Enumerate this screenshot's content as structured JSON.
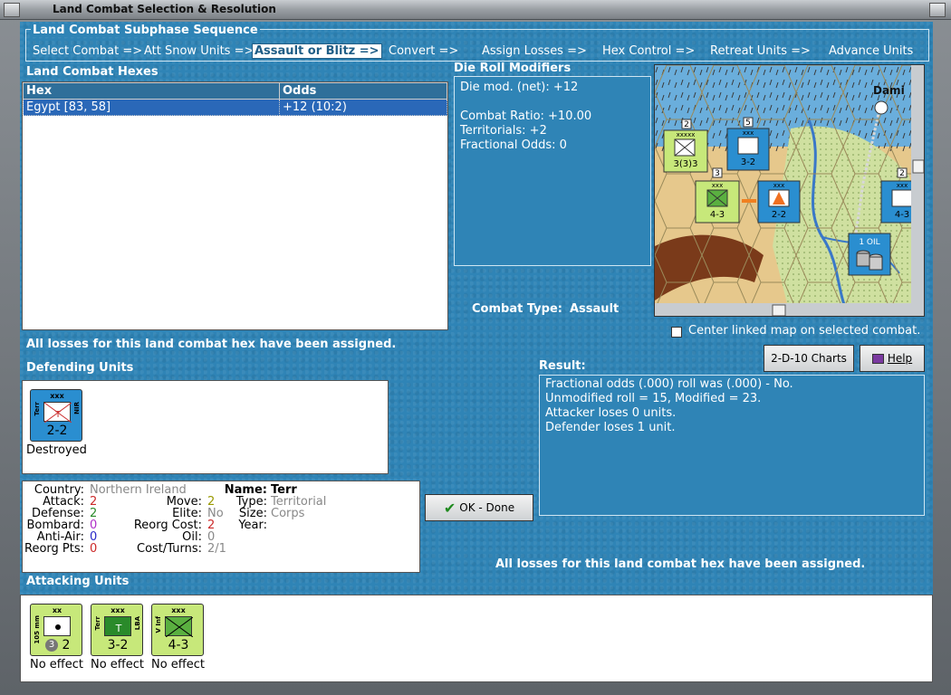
{
  "window": {
    "title": "Land Combat Selection & Resolution"
  },
  "sequence": {
    "title": "Land Combat Subphase Sequence",
    "items": [
      {
        "label": "Select Combat =>",
        "active": false
      },
      {
        "label": "Att Snow Units =>",
        "active": false
      },
      {
        "label": "Assault or Blitz =>",
        "active": true
      },
      {
        "label": "Convert =>",
        "active": false
      },
      {
        "label": "Assign Losses =>",
        "active": false
      },
      {
        "label": "Hex Control =>",
        "active": false
      },
      {
        "label": "Retreat Units =>",
        "active": false
      },
      {
        "label": "Advance Units",
        "active": false
      }
    ]
  },
  "hexes": {
    "title": "Land Combat Hexes",
    "columns": [
      "Hex",
      "Odds"
    ],
    "rows": [
      {
        "hex": "Egypt [83, 58]",
        "odds": "+12 (10:2)"
      }
    ]
  },
  "modifiers": {
    "title": "Die Roll Modifiers",
    "net": "Die mod. (net): +12",
    "ratio": "Combat Ratio: +10.00",
    "territorials": "Territorials: +2",
    "fractional": "Fractional Odds: 0"
  },
  "combat_type": {
    "label": "Combat Type:",
    "value": "Assault"
  },
  "map": {
    "checkbox_label": "Center linked map on selected combat.",
    "checked": false,
    "place_label": "Dami",
    "oil_label": "1 OIL",
    "stack_counts": [
      "2",
      "5",
      "3",
      "2"
    ],
    "units": [
      {
        "size": "xxxxx",
        "str": "3(3)3"
      },
      {
        "size": "xxx",
        "str": "3-2"
      },
      {
        "size": "xxx",
        "str": "4-3"
      },
      {
        "size": "xxx",
        "str": "2-2"
      },
      {
        "size": "xxx",
        "str": "4-3"
      }
    ]
  },
  "status_top": "All losses for this land combat hex have been assigned.",
  "status_bottom": "All losses for this land combat hex have been assigned.",
  "buttons": {
    "charts": "2-D-10 Charts",
    "help": "Help",
    "ok": "OK - Done"
  },
  "result": {
    "title": "Result:",
    "lines": [
      "Fractional odds (.000) roll was (.000)  - No.",
      "Unmodified roll = 15, Modified = 23.",
      "Attacker loses 0 units.",
      "Defender loses 1 unit."
    ]
  },
  "defending": {
    "title": "Defending Units",
    "units": [
      {
        "size": "xxx",
        "left": "Terr",
        "right": "NIR",
        "sym": "T",
        "str": "2-2",
        "status": "Destroyed"
      }
    ]
  },
  "details": {
    "country_k": "Country:",
    "country": "Northern Ireland",
    "attack_k": "Attack:",
    "attack": "2",
    "defense_k": "Defense:",
    "defense": "2",
    "bombard_k": "Bombard:",
    "bombard": "0",
    "antiair_k": "Anti-Air:",
    "antiair": "0",
    "reorg_k": "Reorg Pts:",
    "reorg": "0",
    "move_k": "Move:",
    "move": "2",
    "elite_k": "Elite:",
    "elite": "No",
    "reorgcost_k": "Reorg Cost:",
    "reorgcost": "2",
    "oil_k": "Oil:",
    "oil": "0",
    "costturns_k": "Cost/Turns:",
    "costturns": "2/1",
    "name_k": "Name:",
    "name": "Terr",
    "type_k": "Type:",
    "type": "Territorial",
    "size_k": "Size:",
    "size": "Corps",
    "year_k": "Year:",
    "year": ""
  },
  "attacking": {
    "title": "Attacking Units",
    "units": [
      {
        "size": "xx",
        "left": "105 mm",
        "right": "",
        "sym": "",
        "str": "2",
        "badge": "3",
        "status": "No effect"
      },
      {
        "size": "xxx",
        "left": "Terr",
        "right": "LBA",
        "sym": "T",
        "str": "3-2",
        "badge": "",
        "status": "No effect"
      },
      {
        "size": "xxx",
        "left": "V Inf",
        "right": "",
        "sym": "",
        "str": "4-3",
        "badge": "",
        "status": "No effect"
      }
    ]
  },
  "colors": {
    "panel_blue": "#2f84b6",
    "counter_blue": "#2a8ed0",
    "counter_green": "#c7e87a",
    "attack_red": "#cc2a2a",
    "defense_green": "#2a8a2a",
    "bombard_purple": "#b030c8",
    "antiair_blue": "#2a2ac8"
  }
}
